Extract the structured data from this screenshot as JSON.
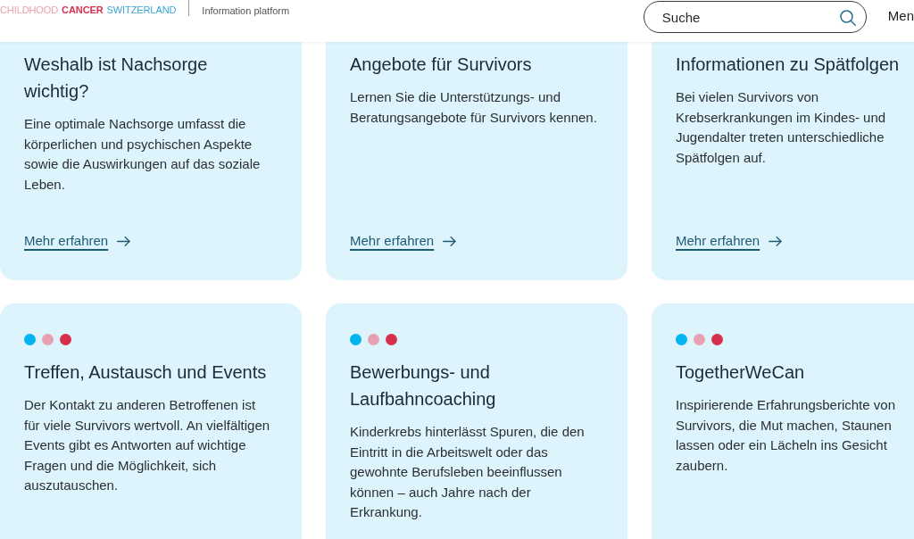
{
  "header": {
    "logo": {
      "words": [
        {
          "text": "CHILDHOOD",
          "color": "#e9a1b1",
          "bold": false
        },
        {
          "text": "CANCER",
          "color": "#d7304f",
          "bold": true
        },
        {
          "text": "SWITZERLAND",
          "color": "#3aa6d8",
          "bold": false
        }
      ]
    },
    "tagline": "Information platform",
    "search": {
      "placeholder": "Suche"
    },
    "menu": "Men"
  },
  "card_rows": [
    {
      "cards": [
        {
          "title": "Weshalb ist Nachsorge wichtig?",
          "text": "Eine optimale Nachsorge umfasst die körperlichen und psychischen Aspekte sowie die Auswirkungen auf das soziale Leben.",
          "link": "Mehr erfahren"
        },
        {
          "title": "Angebote für Survivors",
          "text": "Lernen Sie die Unterstützungs- und Beratungsangebote für Survivors kennen.",
          "link": "Mehr erfahren"
        },
        {
          "title": "Informationen zu Spätfolgen",
          "text": "Bei vielen Survivors von Krebserkrankungen im Kindes- und Jugendalter treten unterschiedliche Spätfolgen auf.",
          "link": "Mehr erfahren"
        }
      ]
    },
    {
      "cards": [
        {
          "dots": [
            {
              "color": "#00b4ef"
            },
            {
              "color": "#e9a1b1"
            },
            {
              "color": "#d7304f"
            }
          ],
          "title": "Treffen, Austausch und Events",
          "text": "Der Kontakt zu anderen Betroffenen ist für viele Survivors wertvoll. An vielfältigen Events gibt es Antworten auf wichtige Fragen und die Möglichkeit, sich auszutauschen."
        },
        {
          "dots": [
            {
              "color": "#00b4ef"
            },
            {
              "color": "#e9a1b1"
            },
            {
              "color": "#d7304f"
            }
          ],
          "title": "Bewerbungs- und Laufbahncoaching",
          "text": "Kinderkrebs hinterlässt Spuren, die den Eintritt in die Arbeitswelt oder das gewohnte Berufsleben beeinflussen können – auch Jahre nach der Erkrankung."
        },
        {
          "dots": [
            {
              "color": "#00b4ef"
            },
            {
              "color": "#e9a1b1"
            },
            {
              "color": "#d7304f"
            }
          ],
          "title": "TogetherWeCan",
          "text": "Inspirierende Erfahrungsberichte von Survivors, die Mut machen, Staunen lassen oder ein Lächeln ins Gesicht zaubern."
        }
      ]
    }
  ]
}
